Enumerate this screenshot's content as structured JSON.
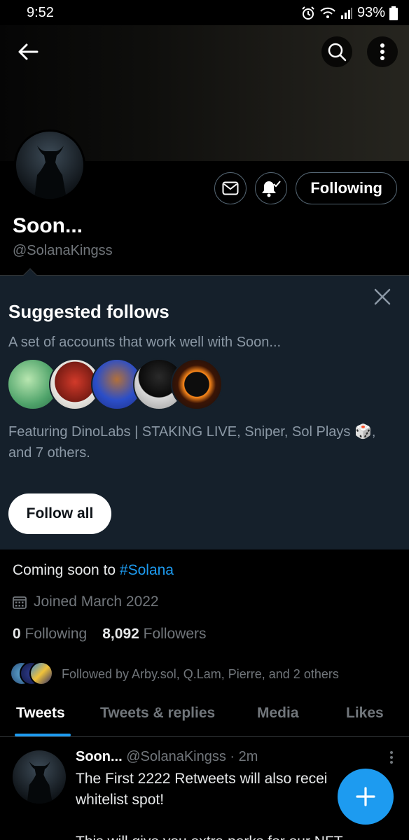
{
  "status_bar": {
    "time": "9:52",
    "battery": "93%"
  },
  "profile": {
    "name": "Soon...",
    "handle": "@SolanaKingss",
    "following_label": "Following",
    "bio_prefix": "Coming soon to ",
    "bio_hashtag": "#Solana",
    "joined": "Joined March 2022",
    "following_count": "0",
    "following_text": "Following",
    "followers_count": "8,092",
    "followers_text": "Followers",
    "followed_by": "Followed by Arby.sol, Q.Lam, Pierre, and 2 others"
  },
  "suggested": {
    "title": "Suggested follows",
    "subtitle": "A set of accounts that work well with Soon...",
    "featuring_part1": "Featuring DinoLabs | STAKING LIVE, Sniper, Sol Plays ",
    "featuring_emoji": "🎲",
    "featuring_part2": ", and 7 others.",
    "follow_all_label": "Follow all"
  },
  "tabs": [
    {
      "label": "Tweets",
      "active": true
    },
    {
      "label": "Tweets & replies",
      "active": false
    },
    {
      "label": "Media",
      "active": false
    },
    {
      "label": "Likes",
      "active": false
    }
  ],
  "tweet": {
    "name": "Soon...",
    "handle": "@SolanaKingss",
    "separator": "·",
    "time": "2m",
    "text_line1": "The First 2222 Retweets will also recei",
    "text_line2": "whitelist spot!",
    "text_line3": "This will give you extra perks for our NFT"
  },
  "colors": {
    "accent": "#1d9bf0",
    "card_bg": "#15202b",
    "muted": "#71767b"
  },
  "icons": [
    "back-arrow-icon",
    "search-icon",
    "more-vertical-icon",
    "mail-icon",
    "bell-check-icon",
    "close-icon",
    "calendar-icon",
    "plus-icon"
  ]
}
